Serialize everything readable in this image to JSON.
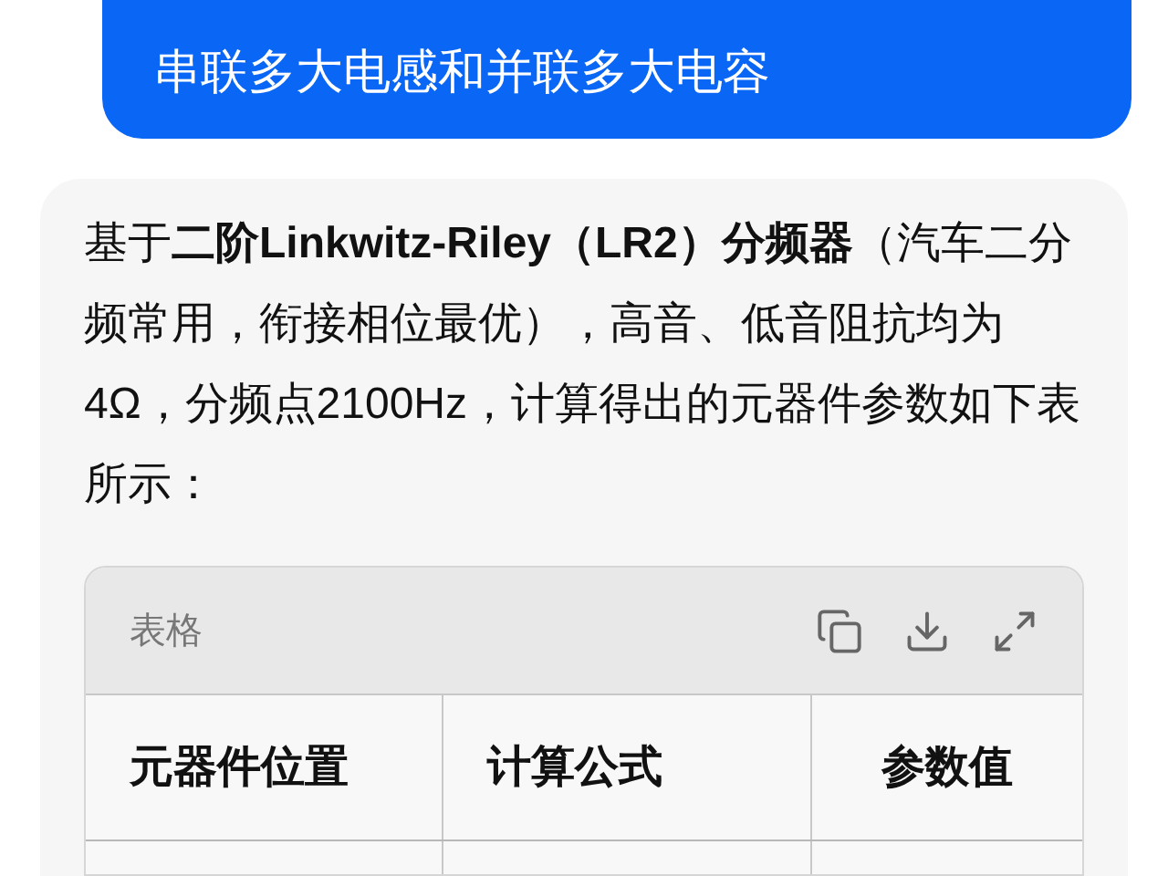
{
  "user_message": {
    "text": "串联多大电感和并联多大电容"
  },
  "assistant_message": {
    "text": "基于**二阶Linkwitz-Riley（LR2）分频器**（汽车二分频常用，衔接相位最优），高音、低音阻抗均为4Ω，分频点2100Hz，计算得出的元器件参数如下表所示：",
    "table": {
      "title": "表格",
      "columns": [
        "元器件位置",
        "计算公式",
        "参数值"
      ]
    }
  }
}
